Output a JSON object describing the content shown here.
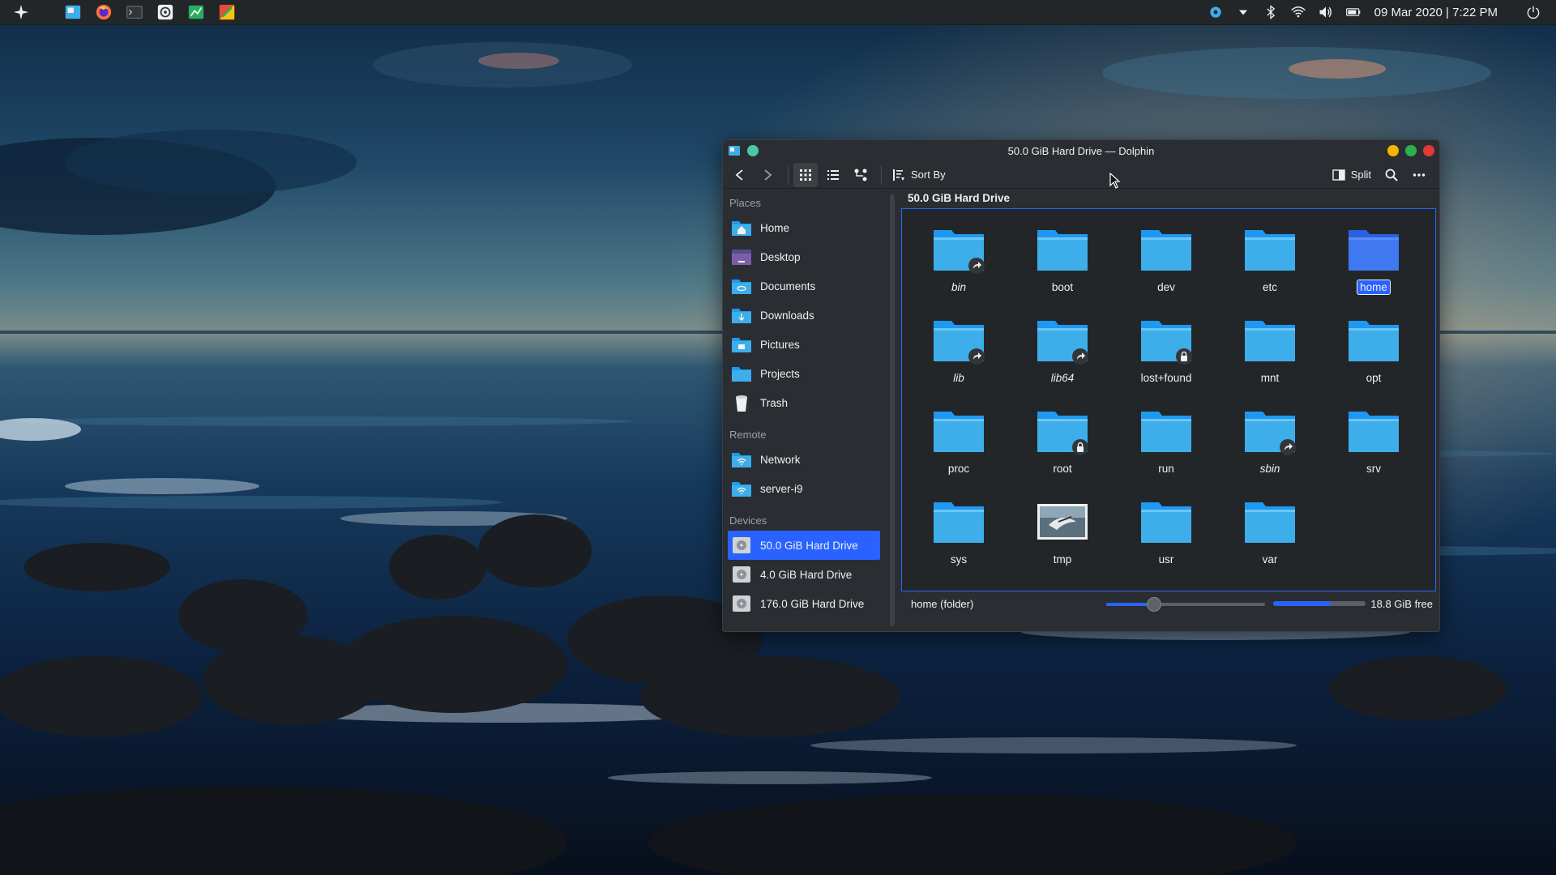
{
  "panel": {
    "launcher_icon": "kde-launcher-icon",
    "apps": [
      {
        "name": "dolphin-icon"
      },
      {
        "name": "firefox-icon"
      },
      {
        "name": "terminal-icon"
      },
      {
        "name": "settings-icon"
      },
      {
        "name": "spreadsheet-icon"
      },
      {
        "name": "krita-icon"
      }
    ],
    "tray": [
      {
        "name": "plasma-settings-icon"
      },
      {
        "name": "expand-arrow-icon"
      },
      {
        "name": "bluetooth-icon"
      },
      {
        "name": "wifi-icon"
      },
      {
        "name": "volume-icon"
      },
      {
        "name": "battery-icon"
      }
    ],
    "clock": "09 Mar 2020 | 7:22 PM",
    "power_icon": "power-icon"
  },
  "window": {
    "title": "50.0 GiB Hard Drive — Dolphin",
    "colors": {
      "minimize": "#f4b400",
      "maximize": "#2bb24c",
      "close": "#e53935",
      "pin": "#4bc7a8"
    },
    "toolbar": {
      "sort_label": "Sort By",
      "split_label": "Split"
    },
    "places": {
      "sections": [
        {
          "header": "Places",
          "items": [
            {
              "label": "Home",
              "icon": "home-folder-icon"
            },
            {
              "label": "Desktop",
              "icon": "desktop-folder-icon"
            },
            {
              "label": "Documents",
              "icon": "documents-folder-icon"
            },
            {
              "label": "Downloads",
              "icon": "downloads-folder-icon"
            },
            {
              "label": "Pictures",
              "icon": "pictures-folder-icon"
            },
            {
              "label": "Projects",
              "icon": "projects-folder-icon"
            },
            {
              "label": "Trash",
              "icon": "trash-icon"
            }
          ]
        },
        {
          "header": "Remote",
          "items": [
            {
              "label": "Network",
              "icon": "network-folder-icon"
            },
            {
              "label": "server-i9",
              "icon": "network-folder-icon"
            }
          ]
        },
        {
          "header": "Devices",
          "items": [
            {
              "label": "50.0 GiB Hard Drive",
              "icon": "hard-drive-icon",
              "selected": true
            },
            {
              "label": "4.0 GiB Hard Drive",
              "icon": "hard-drive-icon"
            },
            {
              "label": "176.0 GiB Hard Drive",
              "icon": "hard-drive-icon"
            }
          ]
        }
      ]
    },
    "location_title": "50.0 GiB Hard Drive",
    "files": [
      {
        "label": "bin",
        "emblem": "symlink",
        "italic": true
      },
      {
        "label": "boot"
      },
      {
        "label": "dev"
      },
      {
        "label": "etc"
      },
      {
        "label": "home",
        "selected": true
      },
      {
        "label": "lib",
        "emblem": "symlink",
        "italic": true
      },
      {
        "label": "lib64",
        "emblem": "symlink",
        "italic": true
      },
      {
        "label": "lost+found",
        "emblem": "lock"
      },
      {
        "label": "mnt"
      },
      {
        "label": "opt"
      },
      {
        "label": "proc"
      },
      {
        "label": "root",
        "emblem": "lock"
      },
      {
        "label": "run"
      },
      {
        "label": "sbin",
        "emblem": "symlink",
        "italic": true
      },
      {
        "label": "srv"
      },
      {
        "label": "sys"
      },
      {
        "label": "tmp",
        "thumbnail": true
      },
      {
        "label": "usr"
      },
      {
        "label": "var"
      }
    ],
    "status": {
      "text": "home (folder)",
      "zoom_level": 0.3,
      "space_used_fraction": 0.62,
      "free_text": "18.8 GiB free"
    }
  }
}
